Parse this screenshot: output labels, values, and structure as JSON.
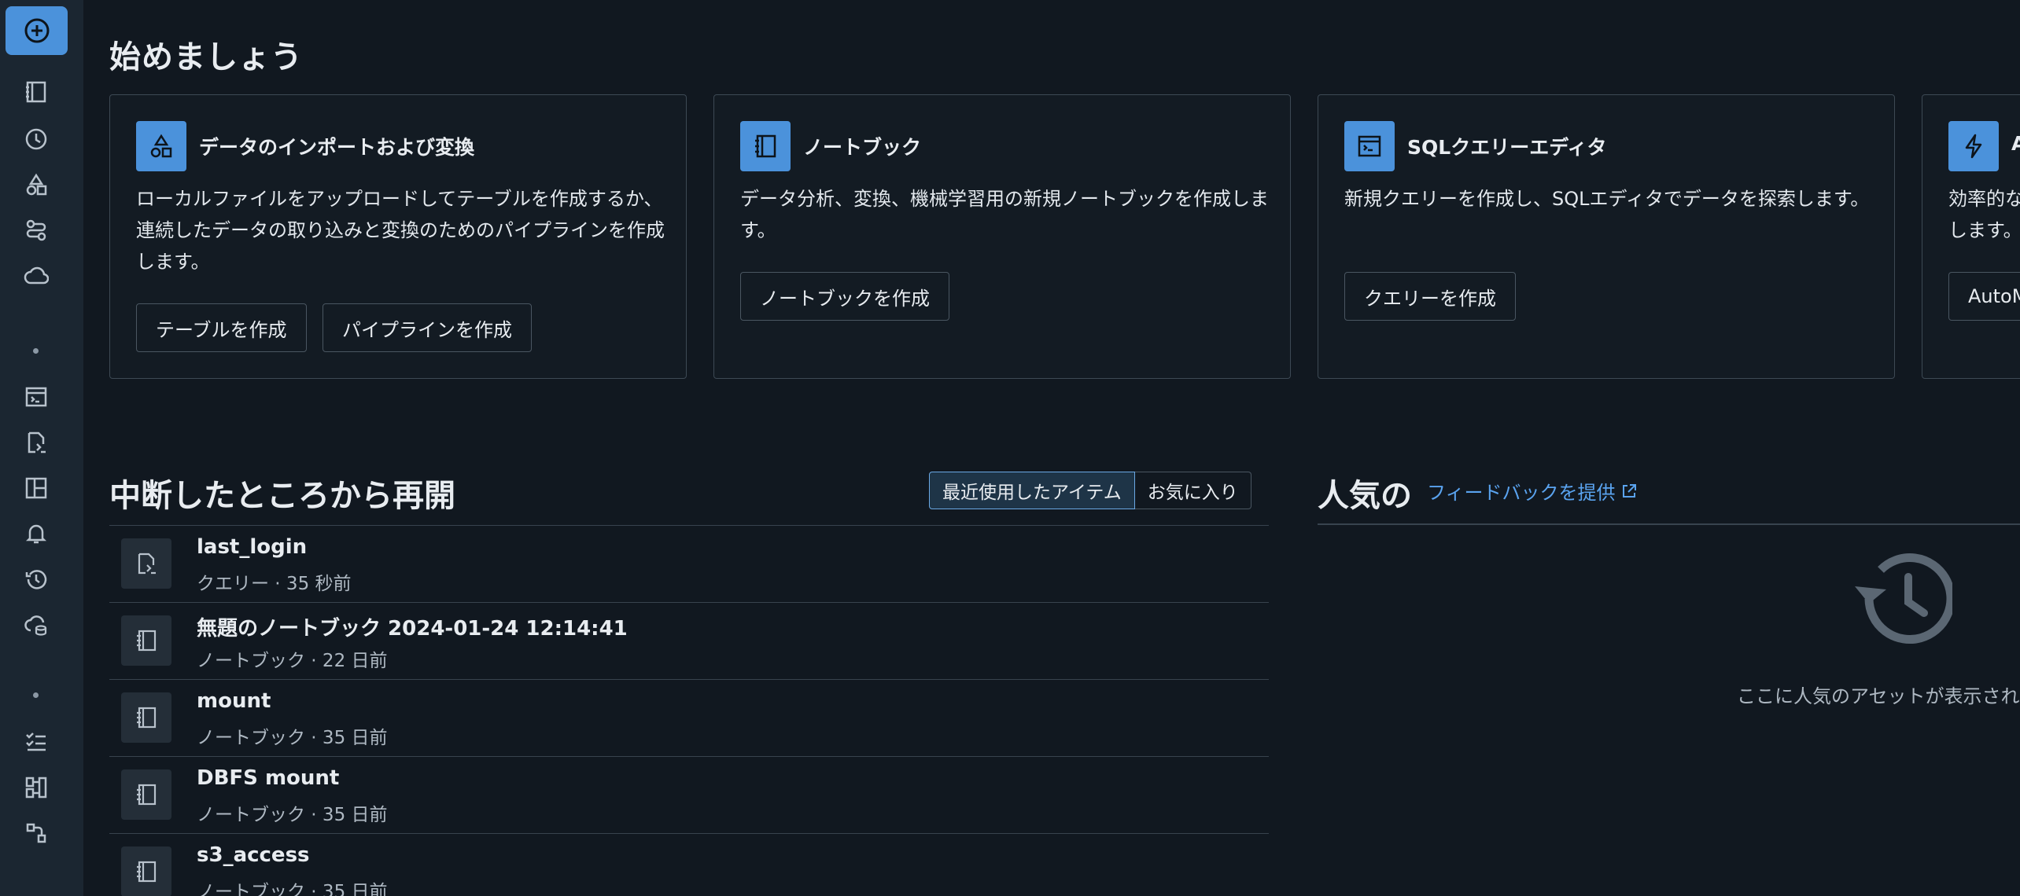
{
  "sidebar": {
    "new_label": "+",
    "icons": [
      "workspace-icon",
      "recents-icon",
      "catalog-icon",
      "workflows-icon",
      "compute-icon",
      "sql-editor-icon",
      "queries-icon",
      "dashboards-icon",
      "alerts-icon",
      "query-history-icon",
      "sql-warehouses-icon",
      "experiments-icon",
      "features-icon",
      "models-icon"
    ]
  },
  "get_started": {
    "title": "始めましょう",
    "cards": [
      {
        "title": "データのインポートおよび変換",
        "desc": "ローカルファイルをアップロードしてテーブルを作成するか、連続したデータの取り込みと変換のためのパイプラインを作成します。",
        "buttons": [
          "テーブルを作成",
          "パイプラインを作成"
        ]
      },
      {
        "title": "ノートブック",
        "desc": "データ分析、変換、機械学習用の新規ノートブックを作成します。",
        "buttons": [
          "ノートブックを作成"
        ]
      },
      {
        "title": "SQLクエリーエディタ",
        "desc": "新規クエリーを作成し、SQLエディタでデータを探索します。",
        "buttons": [
          "クエリーを作成"
        ]
      },
      {
        "title": "A",
        "desc": "効率的な\nします。",
        "buttons": [
          "AutoM"
        ]
      }
    ]
  },
  "resume": {
    "title": "中断したところから再開",
    "tabs": [
      "最近使用したアイテム",
      "お気に入り"
    ],
    "items": [
      {
        "title": "last_login",
        "sub": "クエリー · 35 秒前",
        "icon": "query-file-icon"
      },
      {
        "title": "無題のノートブック 2024-01-24 12:14:41",
        "sub": "ノートブック · 22 日前",
        "icon": "notebook-icon"
      },
      {
        "title": "mount",
        "sub": "ノートブック · 35 日前",
        "icon": "notebook-icon"
      },
      {
        "title": "DBFS mount",
        "sub": "ノートブック · 35 日前",
        "icon": "notebook-icon"
      },
      {
        "title": "s3_access",
        "sub": "ノートブック · 35 日前",
        "icon": "notebook-icon"
      }
    ]
  },
  "popular": {
    "title": "人気の",
    "feedback": "フィードバックを提供",
    "empty_text": "ここに人気のアセットが表示され"
  }
}
